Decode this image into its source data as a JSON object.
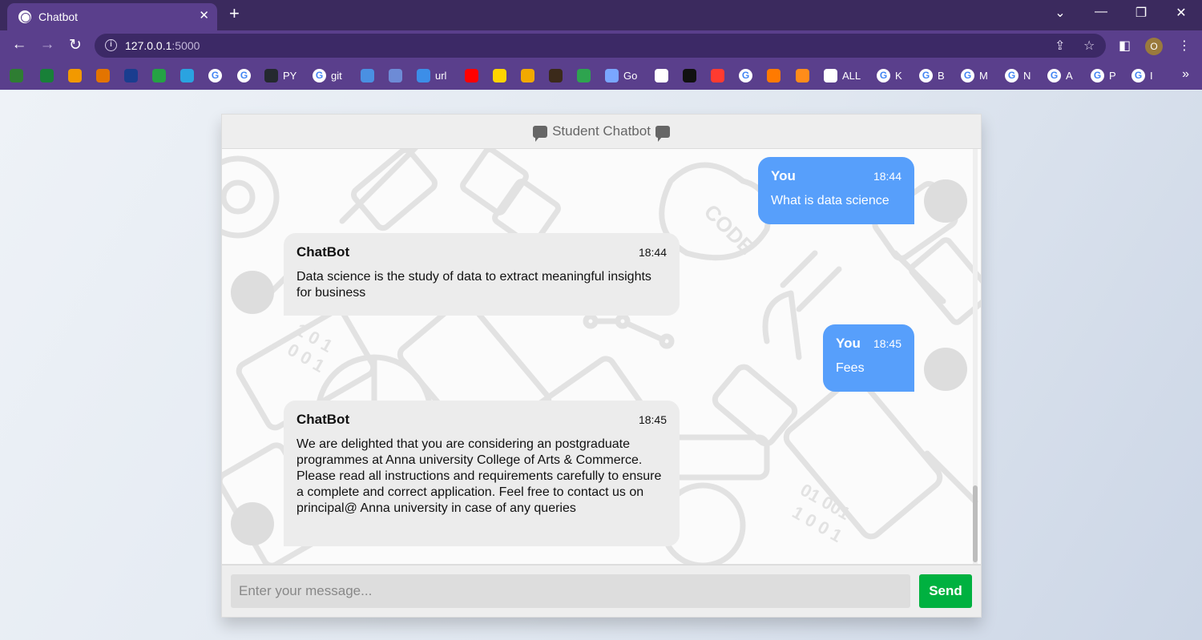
{
  "browser": {
    "tab_title": "Chatbot",
    "tab_close": "✕",
    "new_tab": "+",
    "url_host": "127.0.0.1",
    "url_port": ":5000",
    "profile_initial": "O",
    "bookmarks": [
      {
        "label": "",
        "color": "#2e7d32"
      },
      {
        "label": "",
        "color": "#188038"
      },
      {
        "label": "",
        "color": "#f29900"
      },
      {
        "label": "",
        "color": "#e37400"
      },
      {
        "label": "",
        "color": "#1a3d8f"
      },
      {
        "label": "",
        "color": "#25a244"
      },
      {
        "label": "",
        "color": "#2aa3e0"
      },
      {
        "label": "",
        "g": true
      },
      {
        "label": "",
        "g": true
      },
      {
        "label": "PY",
        "color": "#24292f"
      },
      {
        "label": "git",
        "g": true
      },
      {
        "label": "",
        "color": "#4a90e2"
      },
      {
        "label": "",
        "color": "#6d8bd6"
      },
      {
        "label": "url",
        "color": "#3c8ee8"
      },
      {
        "label": "",
        "color": "#ff0000"
      },
      {
        "label": "",
        "color": "#ffd400"
      },
      {
        "label": "",
        "color": "#f2a900"
      },
      {
        "label": "",
        "color": "#3b2a1a"
      },
      {
        "label": "",
        "color": "#2ea44f"
      },
      {
        "label": "Go",
        "color": "#7aa6ff"
      },
      {
        "label": "",
        "color": "#ffffff"
      },
      {
        "label": "",
        "color": "#111111"
      },
      {
        "label": "",
        "color": "#ff3b30"
      },
      {
        "label": "",
        "g": true
      },
      {
        "label": "",
        "color": "#ff7a00"
      },
      {
        "label": "",
        "color": "#ff8c1a"
      },
      {
        "label": "ALL",
        "color": "#ffffff"
      },
      {
        "label": "K",
        "g": true
      },
      {
        "label": "B",
        "g": true
      },
      {
        "label": "M",
        "g": true
      },
      {
        "label": "N",
        "g": true
      },
      {
        "label": "A",
        "g": true
      },
      {
        "label": "P",
        "g": true
      },
      {
        "label": "I",
        "g": true
      }
    ]
  },
  "chat": {
    "header_title": "Student Chatbot",
    "messages": [
      {
        "side": "right",
        "name": "You",
        "time": "18:44",
        "text": "What is data science"
      },
      {
        "side": "left",
        "name": "ChatBot",
        "time": "18:44",
        "text": "Data science is the study of data to extract meaningful insights for business"
      },
      {
        "side": "right",
        "name": "You",
        "time": "18:45",
        "text": "Fees"
      },
      {
        "side": "left",
        "name": "ChatBot",
        "time": "18:45",
        "text": "We are delighted that you are considering an postgraduate programmes at Anna university College of Arts & Commerce. Please read all instructions and requirements carefully to ensure a complete and correct application. Feel free to contact us on principal@ Anna university in case of any queries"
      }
    ],
    "input_placeholder": "Enter your message...",
    "send_label": "Send"
  },
  "colors": {
    "bot_bubble": "#ececec",
    "user_bubble": "#579ffb",
    "send_button": "#00b140",
    "chrome": "#5a3f8c"
  }
}
